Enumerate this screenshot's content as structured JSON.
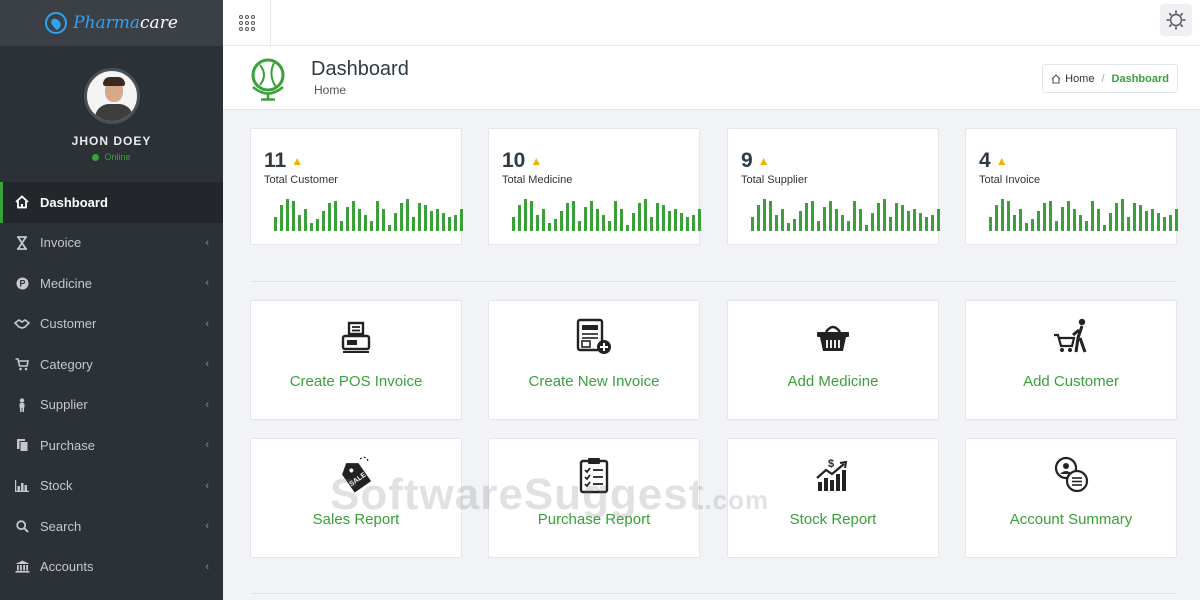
{
  "brand": {
    "name_prefix": "Pharma",
    "name_suffix": "care",
    "accent": "#3aa03a",
    "logo_color": "#2ea3f2"
  },
  "user": {
    "name": "JHON DOEY",
    "status": "Online"
  },
  "sidebar": {
    "items": [
      {
        "label": "Dashboard",
        "icon": "home-icon",
        "active": true
      },
      {
        "label": "Invoice",
        "icon": "hourglass-icon"
      },
      {
        "label": "Medicine",
        "icon": "pill-icon"
      },
      {
        "label": "Customer",
        "icon": "handshake-icon"
      },
      {
        "label": "Category",
        "icon": "cart-icon"
      },
      {
        "label": "Supplier",
        "icon": "person-icon"
      },
      {
        "label": "Purchase",
        "icon": "documents-icon"
      },
      {
        "label": "Stock",
        "icon": "bar-chart-icon"
      },
      {
        "label": "Search",
        "icon": "search-icon"
      },
      {
        "label": "Accounts",
        "icon": "bank-icon"
      }
    ],
    "caret": "‹"
  },
  "header": {
    "title": "Dashboard",
    "subtitle": "Home"
  },
  "breadcrumb": {
    "home": "Home",
    "separator": "/",
    "current": "Dashboard"
  },
  "stats": [
    {
      "value": "11",
      "label": "Total Customer",
      "trend": "▲"
    },
    {
      "value": "10",
      "label": "Total Medicine",
      "trend": "▲"
    },
    {
      "value": "9",
      "label": "Total Supplier",
      "trend": "▲"
    },
    {
      "value": "4",
      "label": "Total Invoice",
      "trend": "▲"
    }
  ],
  "sparkline": [
    14,
    26,
    32,
    30,
    16,
    22,
    8,
    12,
    20,
    28,
    30,
    10,
    24,
    30,
    22,
    16,
    10,
    30,
    22,
    6,
    18,
    28,
    32,
    14,
    28,
    26,
    20,
    22,
    18,
    14,
    16,
    22
  ],
  "actions": [
    {
      "label": "Create POS Invoice",
      "icon": "pos-register-icon"
    },
    {
      "label": "Create New Invoice",
      "icon": "invoice-add-icon"
    },
    {
      "label": "Add Medicine",
      "icon": "basket-icon"
    },
    {
      "label": "Add Customer",
      "icon": "shopper-cart-icon"
    },
    {
      "label": "Sales Report",
      "icon": "sale-tag-icon"
    },
    {
      "label": "Purchase Report",
      "icon": "clipboard-checklist-icon"
    },
    {
      "label": "Stock Report",
      "icon": "stock-growth-icon"
    },
    {
      "label": "Account Summary",
      "icon": "account-coins-icon"
    }
  ],
  "watermark": {
    "main": "SoftwareSuggest",
    "suffix": ".com"
  }
}
